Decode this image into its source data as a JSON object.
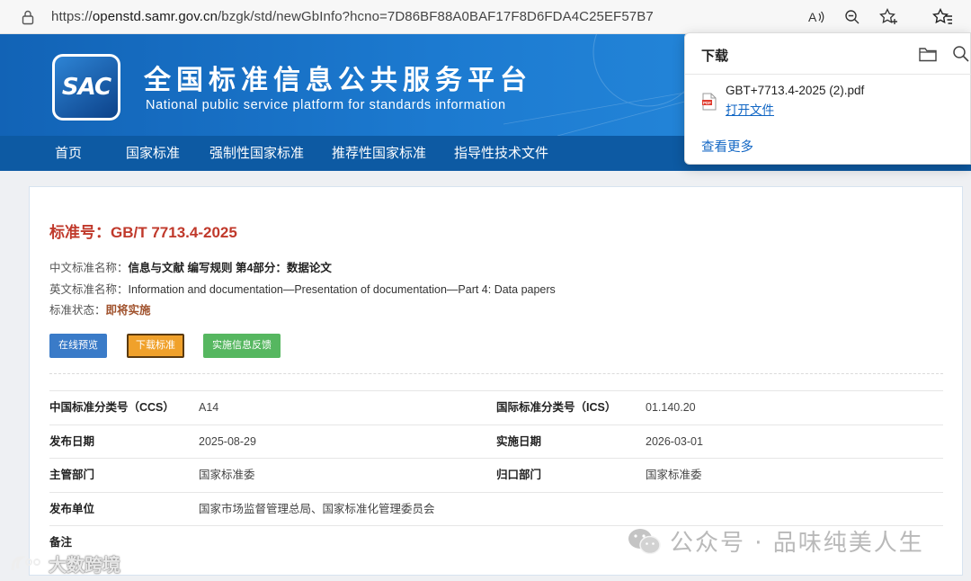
{
  "browser": {
    "url_prefix": "https://",
    "url_host": "openstd.samr.gov.cn",
    "url_path": "/bzgk/std/newGbInfo?hcno=7D86BF88A0BAF17F8D6FDA4C25EF57B7",
    "icons": [
      "lock-icon",
      "read-aloud-icon",
      "zoom-out-icon",
      "add-favorite-icon",
      "favorites-icon"
    ]
  },
  "site": {
    "logo_text": "SAC",
    "title_cn": "全国标准信息公共服务平台",
    "title_en": "National public service platform  for standards information"
  },
  "nav": {
    "items": [
      {
        "label": "首页"
      },
      {
        "label": "国家标准"
      },
      {
        "label": "强制性国家标准"
      },
      {
        "label": "推荐性国家标准"
      },
      {
        "label": "指导性技术文件"
      }
    ]
  },
  "standard": {
    "number_label": "标准号：",
    "number": "GB/T 7713.4-2025",
    "cn_name_label": "中文标准名称：",
    "cn_name": "信息与文献 编写规则 第4部分：数据论文",
    "en_name_label": "英文标准名称：",
    "en_name": "Information and documentation—Presentation of documentation—Part 4: Data papers",
    "status_label": "标准状态：",
    "status": "即将实施"
  },
  "buttons": {
    "preview": "在线预览",
    "download": "下载标准",
    "feedback": "实施信息反馈"
  },
  "info_table": {
    "rows": [
      {
        "l1": "中国标准分类号（CCS）",
        "v1": "A14",
        "l2": "国际标准分类号（ICS）",
        "v2": "01.140.20"
      },
      {
        "l1": "发布日期",
        "v1": "2025-08-29",
        "l2": "实施日期",
        "v2": "2026-03-01"
      },
      {
        "l1": "主管部门",
        "v1": "国家标准委",
        "l2": "归口部门",
        "v2": "国家标准委"
      },
      {
        "l1": "发布单位",
        "v1": "国家市场监督管理总局、国家标准化管理委员会",
        "l2": "",
        "v2": ""
      },
      {
        "l1": "备注",
        "v1": "",
        "l2": "",
        "v2": ""
      }
    ]
  },
  "download_panel": {
    "title": "下载",
    "file_name": "GBT+7713.4-2025 (2).pdf",
    "open_file": "打开文件",
    "see_more": "查看更多"
  },
  "watermarks": {
    "right": "公众号 · 品味纯美人生",
    "left": "大数跨境"
  },
  "colors": {
    "header_blue": "#1c7ad0",
    "nav_blue": "#0d5aa3",
    "std_red": "#c0392b",
    "btn_preview": "#3a7bc8",
    "btn_download": "#f0a12b",
    "btn_feedback": "#56b760",
    "link_blue": "#1166c4"
  }
}
